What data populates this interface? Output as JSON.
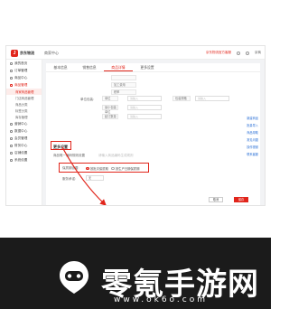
{
  "header": {
    "brand": "京东物流",
    "product": "商家中心",
    "link": "京东物流官方客服",
    "user": "京商"
  },
  "sidebar": {
    "items": [
      {
        "label": "我的首页",
        "icon": "home-icon"
      },
      {
        "label": "订单管理",
        "icon": "order-icon"
      },
      {
        "label": "商品中心",
        "icon": "goods-icon"
      },
      {
        "label": "商品管理",
        "icon": "box-icon",
        "active": true
      }
    ],
    "subs": [
      "商家商品管理",
      "门店商品管理",
      "商品分类",
      "标签分类",
      "库存管理"
    ],
    "more": [
      "营销中心",
      "数据中心",
      "会员管理",
      "财务中心",
      "店铺设置",
      "系统设置"
    ]
  },
  "tabs": [
    {
      "label": "基本信息"
    },
    {
      "label": "销售信息"
    },
    {
      "label": "商品详情",
      "active": true
    },
    {
      "label": "更多设置"
    }
  ],
  "form": {
    "rows_top": [
      "加工费用",
      "税率"
    ],
    "unit_label": "单位包装:",
    "unit_cells": [
      "单位",
      "包装规格",
      "最小包装单位",
      "起订数量"
    ],
    "placeholder": "请输入",
    "more_settings": "更多设置",
    "sku_label": "商品唯一编码规则设置",
    "sku_placeholder": "请输入商品编码生成规则",
    "expire_label": "保质期设置:",
    "expire_opt1": "按批次保质期",
    "expire_opt2": "按生产日期保质期",
    "service_label": "服务承诺:",
    "service_value": "无"
  },
  "help": [
    "新建商品",
    "批量导入",
    "商品帮助",
    "常见问题",
    "操作视频",
    "联系客服"
  ],
  "buttons": {
    "cancel": "取消",
    "save": "保存"
  },
  "watermark": {
    "text": "零氪手游网",
    "url": "www.ok6o.com"
  }
}
